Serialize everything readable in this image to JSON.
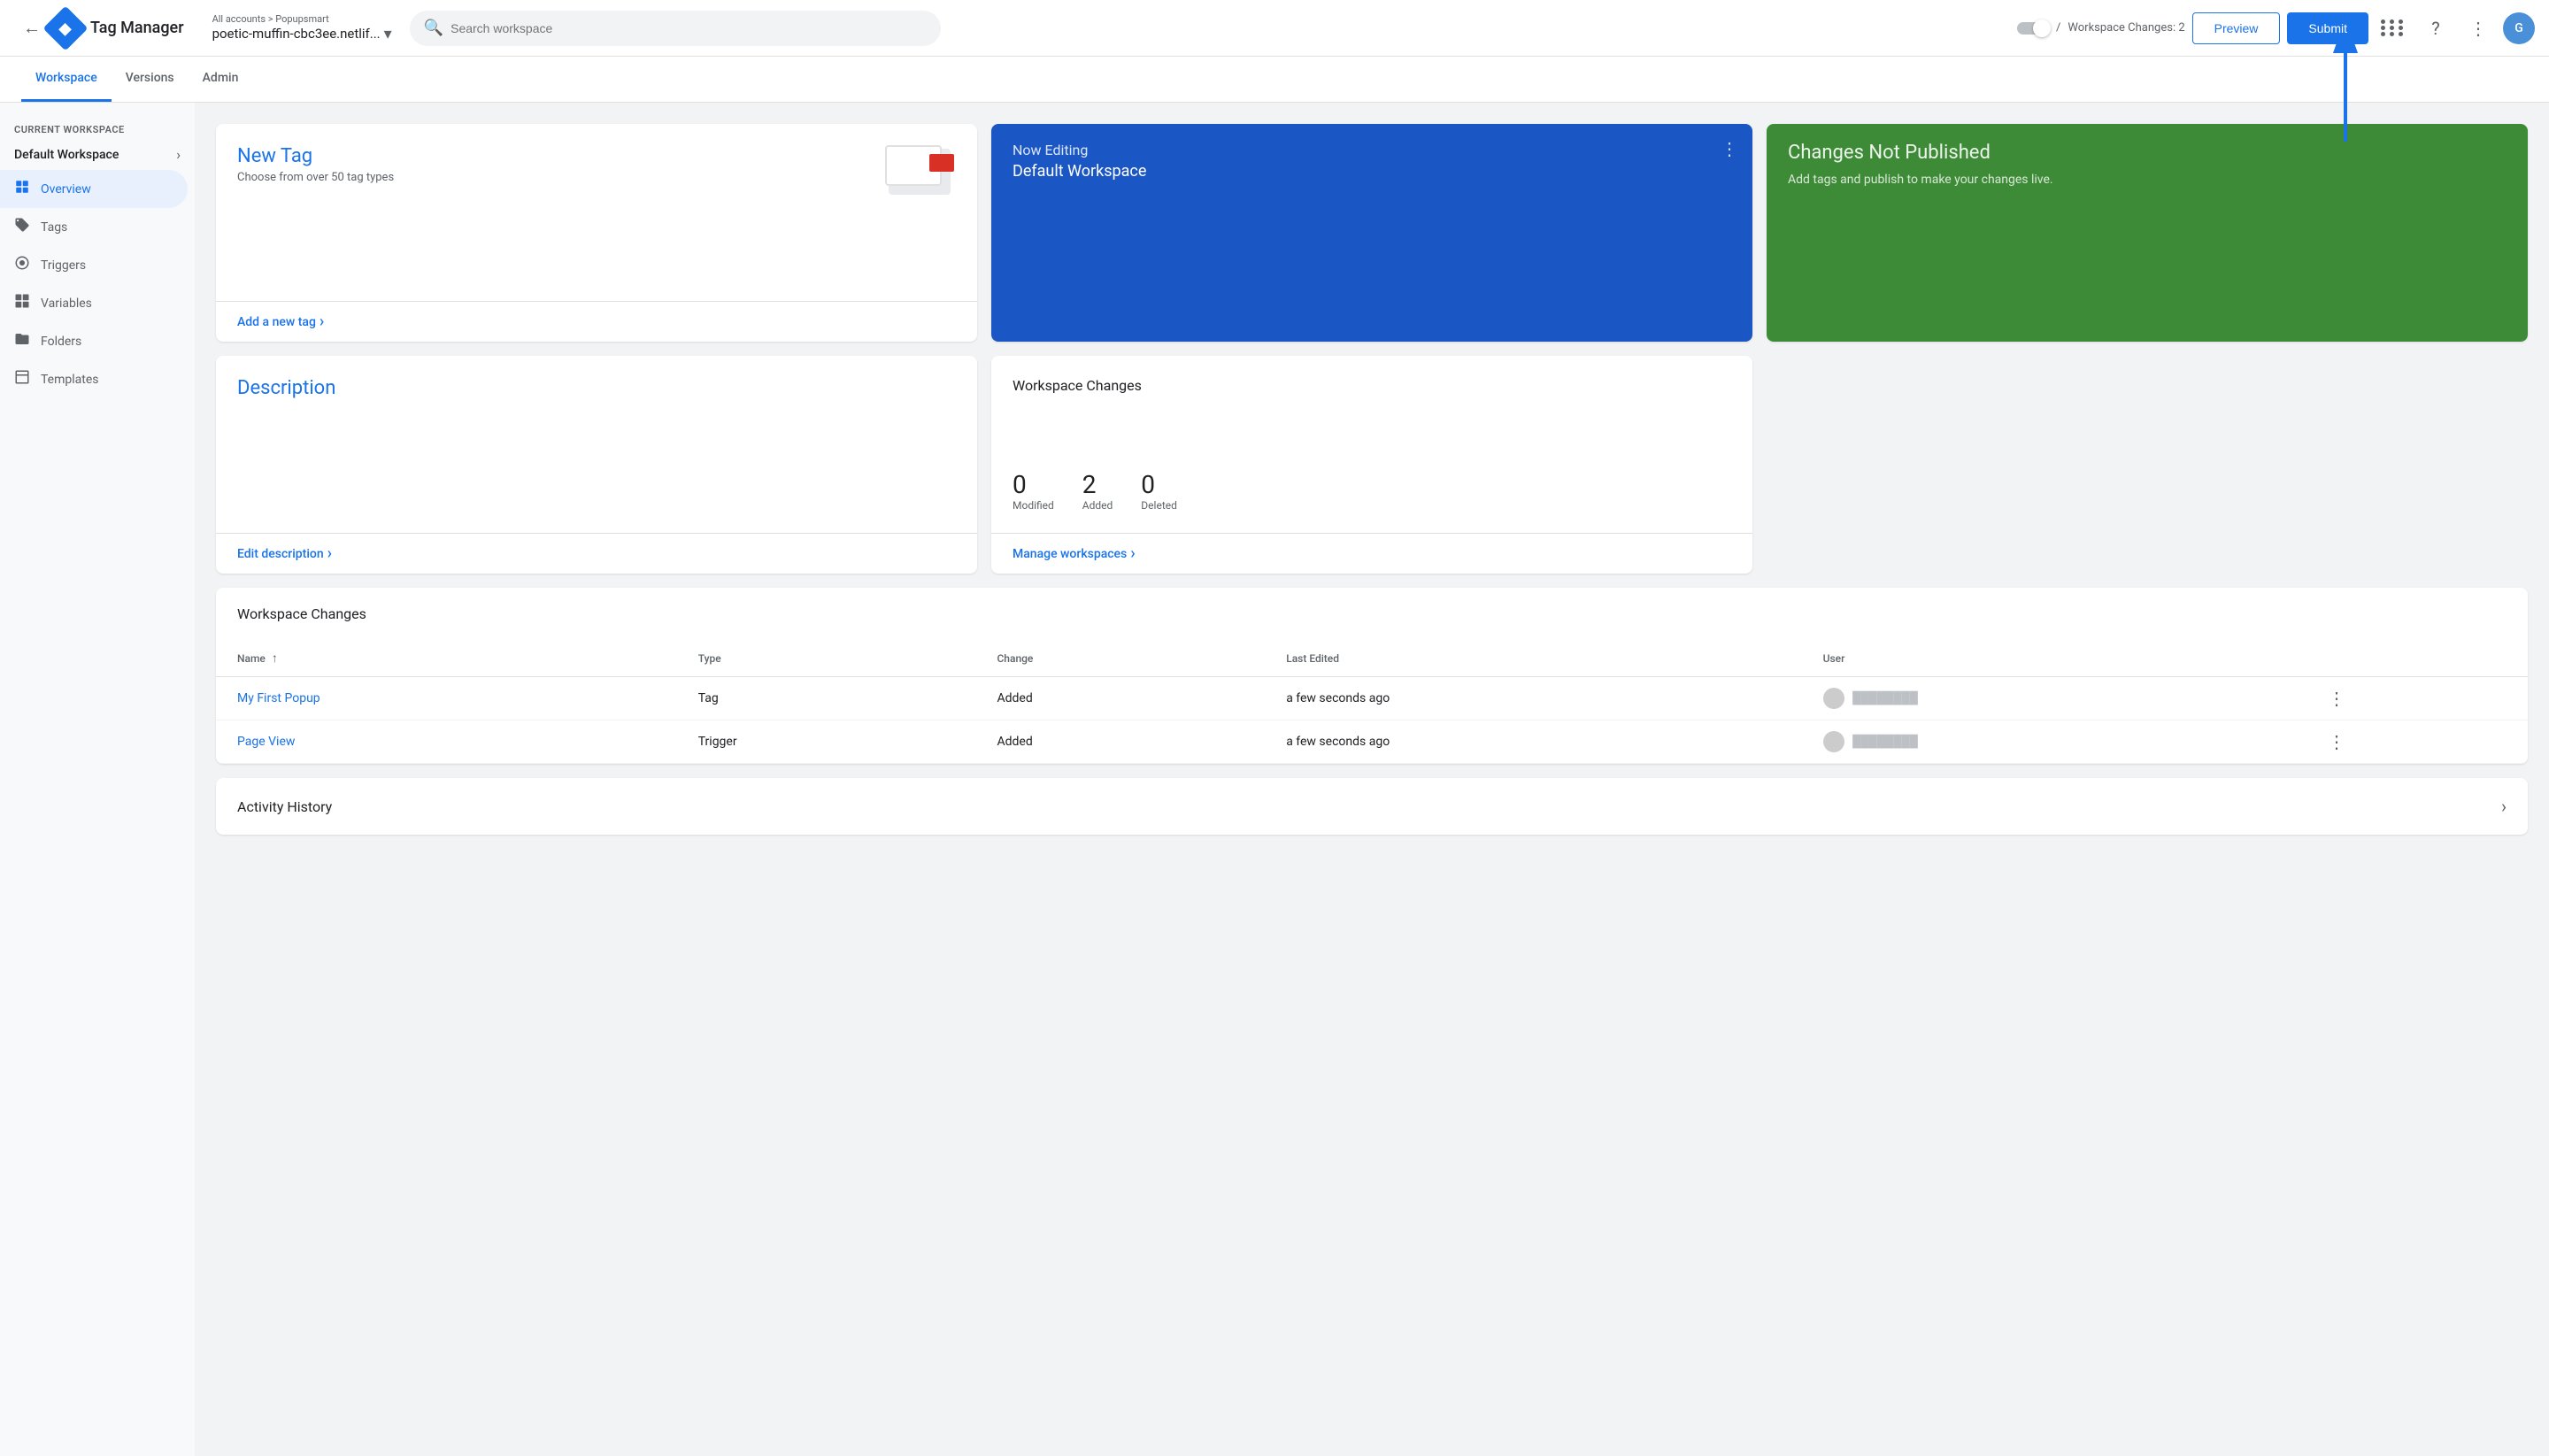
{
  "header": {
    "back_icon": "←",
    "app_name": "Tag Manager",
    "breadcrumb": "All accounts > Popupsmart",
    "account_name": "poetic-muffin-cbc3ee.netlif...",
    "search_placeholder": "Search workspace",
    "workspace_changes_label": "Workspace Changes: 2",
    "preview_label": "Preview",
    "submit_label": "Submit"
  },
  "nav": {
    "tabs": [
      {
        "id": "workspace",
        "label": "Workspace",
        "active": true
      },
      {
        "id": "versions",
        "label": "Versions",
        "active": false
      },
      {
        "id": "admin",
        "label": "Admin",
        "active": false
      }
    ]
  },
  "sidebar": {
    "section_label": "CURRENT WORKSPACE",
    "workspace_name": "Default Workspace",
    "items": [
      {
        "id": "overview",
        "label": "Overview",
        "icon": "▣",
        "active": true
      },
      {
        "id": "tags",
        "label": "Tags",
        "icon": "🏷",
        "active": false
      },
      {
        "id": "triggers",
        "label": "Triggers",
        "icon": "◎",
        "active": false
      },
      {
        "id": "variables",
        "label": "Variables",
        "icon": "▦",
        "active": false
      },
      {
        "id": "folders",
        "label": "Folders",
        "icon": "▬",
        "active": false
      },
      {
        "id": "templates",
        "label": "Templates",
        "icon": "□",
        "active": false
      }
    ]
  },
  "cards": {
    "new_tag": {
      "title": "New Tag",
      "description": "Choose from over 50 tag types",
      "link": "Add a new tag"
    },
    "now_editing": {
      "label": "Now Editing",
      "workspace": "Default Workspace"
    },
    "not_published": {
      "title": "Changes Not Published",
      "description": "Add tags and publish to make your changes live."
    },
    "description": {
      "title": "Description",
      "link": "Edit description"
    },
    "workspace_changes": {
      "title": "Workspace Changes",
      "stats": [
        {
          "number": "0",
          "label": "Modified"
        },
        {
          "number": "2",
          "label": "Added"
        },
        {
          "number": "0",
          "label": "Deleted"
        }
      ],
      "link": "Manage workspaces"
    }
  },
  "table": {
    "section_title": "Workspace Changes",
    "columns": [
      {
        "id": "name",
        "label": "Name",
        "sortable": true
      },
      {
        "id": "type",
        "label": "Type"
      },
      {
        "id": "change",
        "label": "Change"
      },
      {
        "id": "last_edited",
        "label": "Last Edited"
      },
      {
        "id": "user",
        "label": "User"
      }
    ],
    "rows": [
      {
        "name": "My First Popup",
        "type": "Tag",
        "change": "Added",
        "last_edited": "a few seconds ago",
        "user": ""
      },
      {
        "name": "Page View",
        "type": "Trigger",
        "change": "Added",
        "last_edited": "a few seconds ago",
        "user": ""
      }
    ]
  },
  "activity": {
    "title": "Activity History"
  }
}
